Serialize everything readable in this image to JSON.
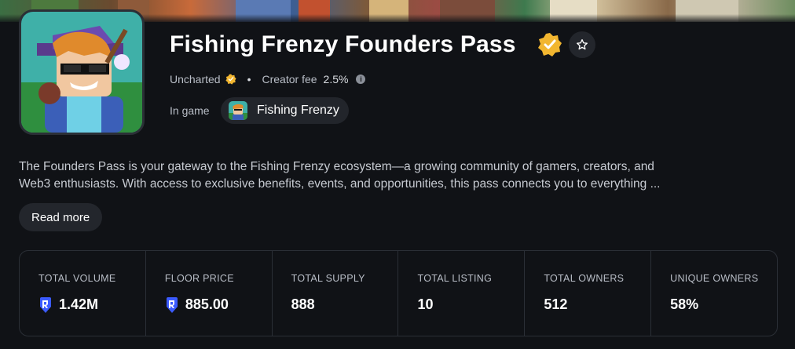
{
  "collection": {
    "title": "Fishing Frenzy Founders Pass",
    "creator": "Uncharted",
    "creator_fee_label": "Creator fee",
    "creator_fee_value": "2.5%",
    "in_game_label": "In game",
    "game_name": "Fishing Frenzy",
    "description_line1": "The Founders Pass is your gateway to the Fishing Frenzy ecosystem—a growing community of gamers, creators, and",
    "description_line2": "Web3 enthusiasts. With access to exclusive benefits, events, and opportunities, this pass connects you to everything ...",
    "read_more_label": "Read more"
  },
  "stats": [
    {
      "label": "TOTAL VOLUME",
      "value": "1.42M",
      "coin": true
    },
    {
      "label": "FLOOR PRICE",
      "value": "885.00",
      "coin": true
    },
    {
      "label": "TOTAL SUPPLY",
      "value": "888",
      "coin": false
    },
    {
      "label": "TOTAL LISTING",
      "value": "10",
      "coin": false
    },
    {
      "label": "TOTAL OWNERS",
      "value": "512",
      "coin": false
    },
    {
      "label": "UNIQUE OWNERS",
      "value": "58%",
      "coin": false
    }
  ],
  "colors": {
    "background": "#101216",
    "verified_badge": "#f2b630",
    "coin": "#3b5bff",
    "chip": "#22252b"
  },
  "icons": {
    "verified": "verified-badge-icon",
    "favorite": "star-icon",
    "info": "info-icon",
    "currency": "ronin-coin-icon"
  }
}
